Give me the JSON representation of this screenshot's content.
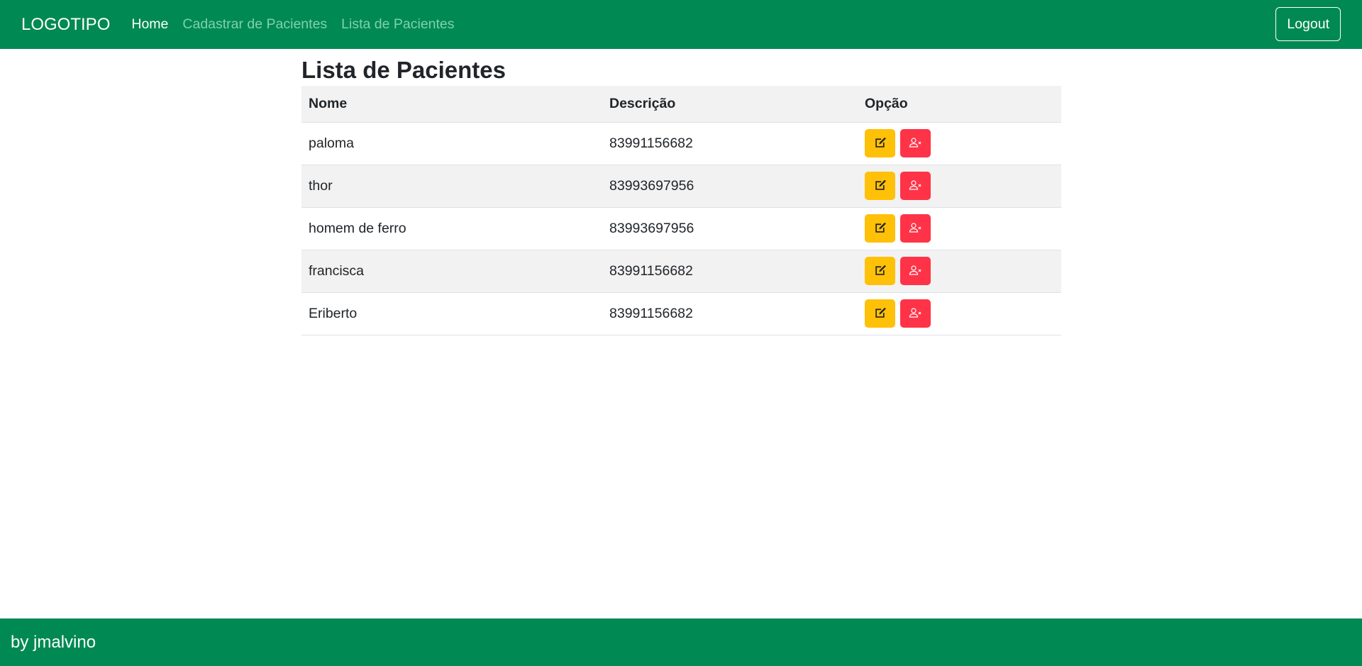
{
  "nav": {
    "brand": "LOGOTIPO",
    "links": [
      "Home",
      "Cadastrar de Pacientes",
      "Lista de Pacientes"
    ],
    "logout": "Logout"
  },
  "main": {
    "title": "Lista de Pacientes",
    "headers": [
      "Nome",
      "Descrição",
      "Opção"
    ],
    "rows": [
      {
        "nome": "paloma",
        "descricao": "83991156682"
      },
      {
        "nome": "thor",
        "descricao": "83993697956"
      },
      {
        "nome": "homem de ferro",
        "descricao": "83993697956"
      },
      {
        "nome": "francisca",
        "descricao": "83991156682"
      },
      {
        "nome": "Eriberto",
        "descricao": "83991156682"
      }
    ]
  },
  "colors": {
    "brand": "#008952",
    "edit": "#ffc107",
    "delete": "#ff3347"
  },
  "icons": {
    "edit": "pencil-square-icon",
    "delete": "person-x-icon"
  },
  "footer": {
    "text": "by jmalvino"
  }
}
